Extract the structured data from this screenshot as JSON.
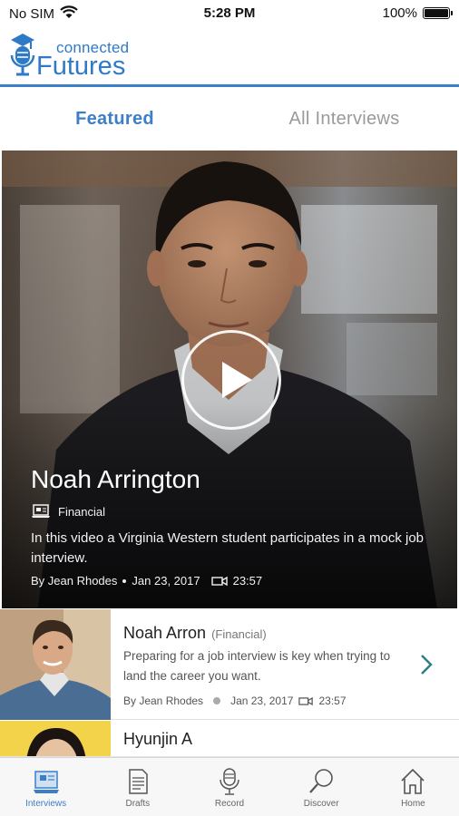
{
  "status_bar": {
    "carrier": "No SIM",
    "time": "5:28 PM",
    "battery": "100%",
    "icons": [
      "wifi-icon",
      "battery-icon"
    ]
  },
  "header": {
    "logo_small": "connected",
    "logo_big": "Futures",
    "logo_icon": "microphone-icon"
  },
  "tabs": [
    {
      "label": "Featured",
      "active": true
    },
    {
      "label": "All Interviews",
      "active": false
    }
  ],
  "featured": {
    "name": "Noah Arrington",
    "category": "Financial",
    "category_icon": "laptop-icon",
    "description": "In this video a Virginia Western student participates in a mock job interview.",
    "author": "By Jean Rhodes",
    "date": "Jan 23, 2017",
    "duration": "23:57",
    "play_icon": "play-icon"
  },
  "list": [
    {
      "name": "Noah Arron",
      "category": "(Financial)",
      "description": "Preparing for a job interview is key when trying to land the career you want.",
      "author": "By Jean Rhodes",
      "date": "Jan 23, 2017",
      "duration": "23:57"
    },
    {
      "name": "Hyunjin A"
    }
  ],
  "bottom_nav": [
    {
      "label": "Interviews",
      "icon": "interviews-icon",
      "active": true
    },
    {
      "label": "Drafts",
      "icon": "drafts-icon",
      "active": false
    },
    {
      "label": "Record",
      "icon": "record-icon",
      "active": false
    },
    {
      "label": "Discover",
      "icon": "discover-icon",
      "active": false
    },
    {
      "label": "Home",
      "icon": "home-icon",
      "active": false
    }
  ],
  "colors": {
    "accent": "#3c7fc9",
    "inactive_tab": "#9a9a9a",
    "nav_active": "#3c7fc9",
    "chevron": "#2e7f86"
  }
}
